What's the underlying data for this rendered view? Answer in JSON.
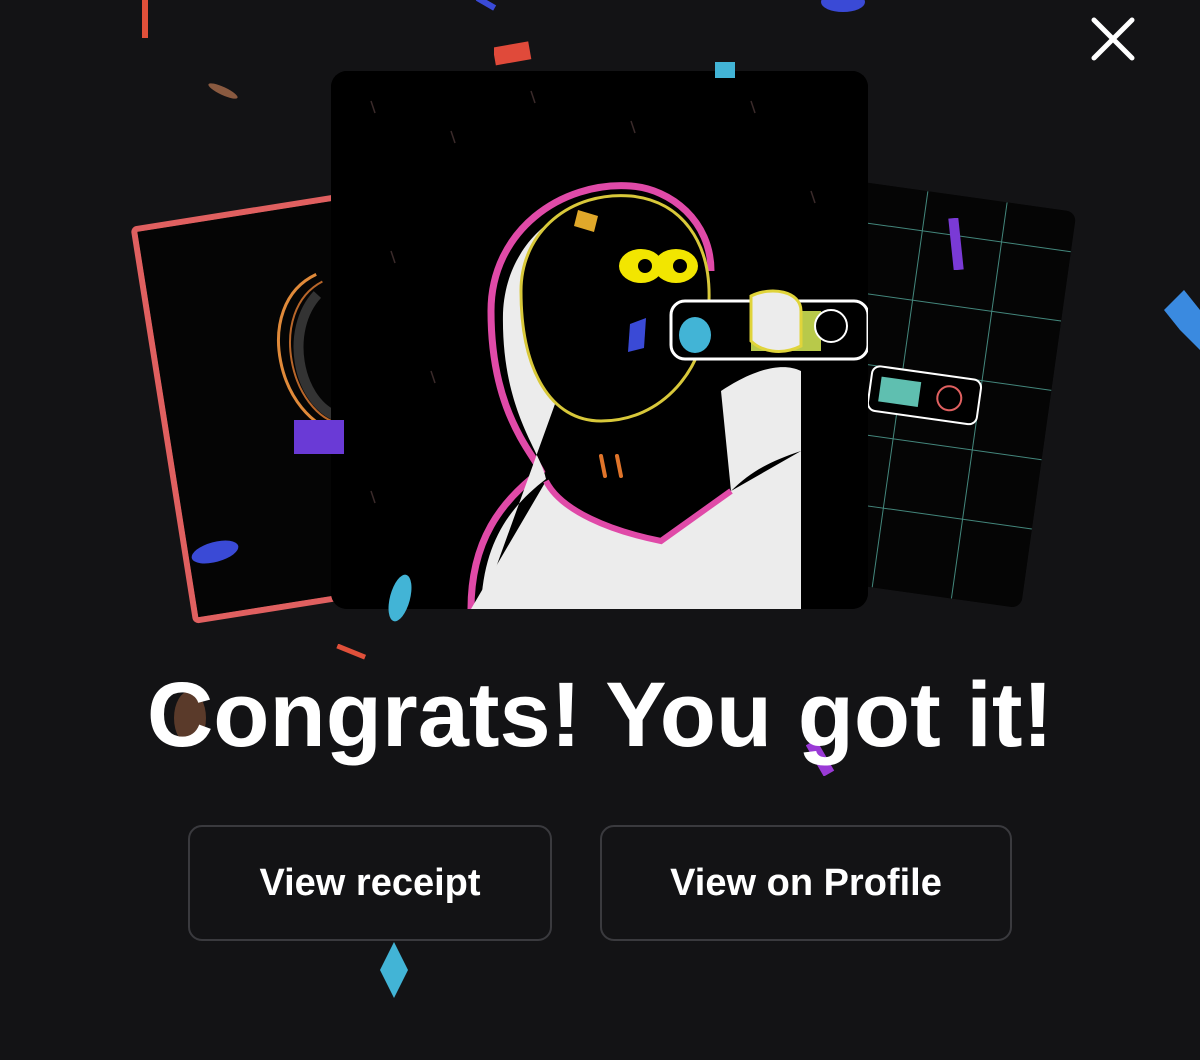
{
  "modal": {
    "headline": "Congrats! You got it!",
    "close_icon": "close-icon"
  },
  "actions": {
    "view_receipt_label": "View receipt",
    "view_profile_label": "View on Profile"
  },
  "colors": {
    "background": "#131315",
    "text": "#ffffff",
    "button_border": "#3a3a3e",
    "left_card_border": "#e06060",
    "character_outline": "#e04aa8",
    "eyes": "#f2e600",
    "drink": "#b8c94a"
  }
}
